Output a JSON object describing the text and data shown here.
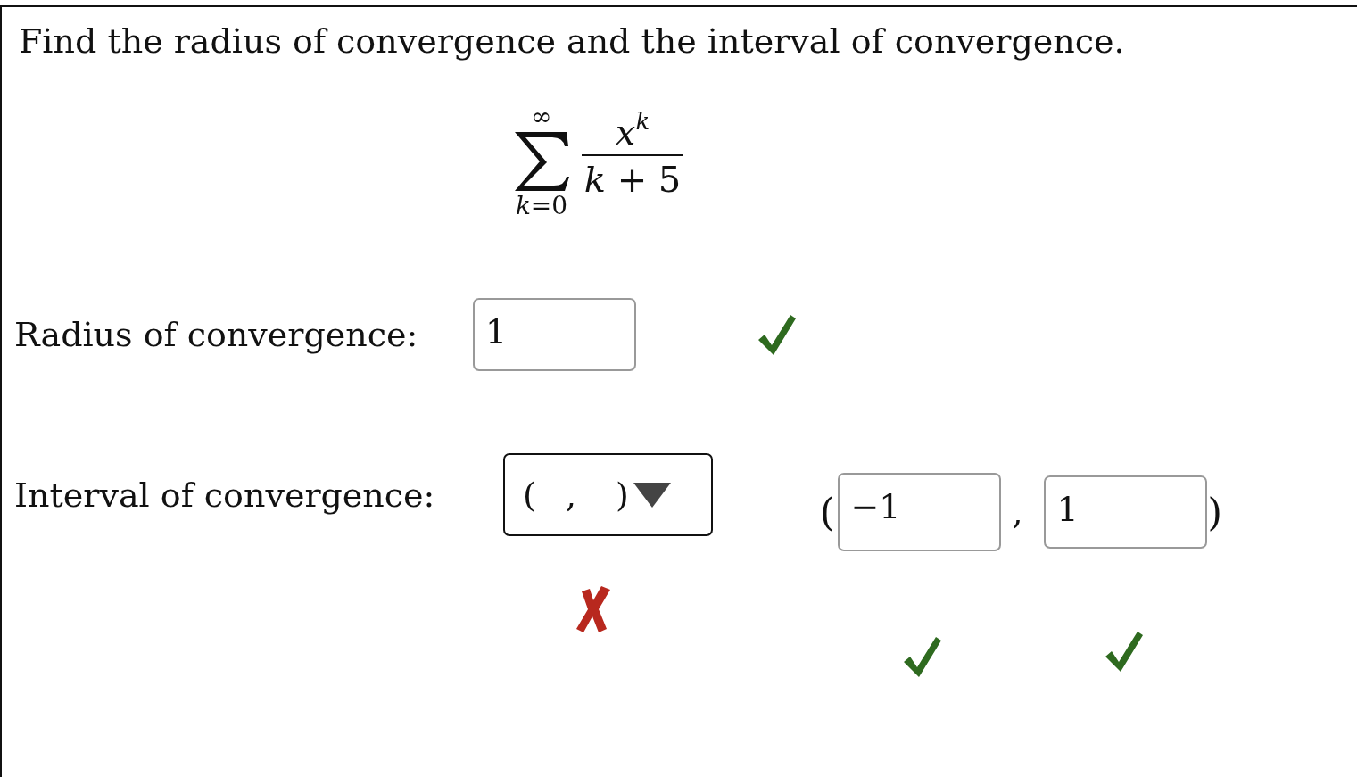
{
  "question": "Find the radius of convergence and the interval of convergence.",
  "formula": {
    "upper": "∞",
    "lower": "*k*=0",
    "numerator_base": "x",
    "numerator_exp": "k",
    "denominator": "*k* + 5"
  },
  "radius": {
    "label": "Radius of convergence:",
    "value": "1",
    "correct": true
  },
  "interval": {
    "label": "Interval of convergence:",
    "dropdown": {
      "open": "(",
      "separator": ",",
      "close": ")",
      "correct": false
    },
    "open": "(",
    "separator": ",",
    "close": ")",
    "fields": [
      {
        "value": "−1",
        "correct": true
      },
      {
        "value": "1",
        "correct": true
      }
    ]
  }
}
